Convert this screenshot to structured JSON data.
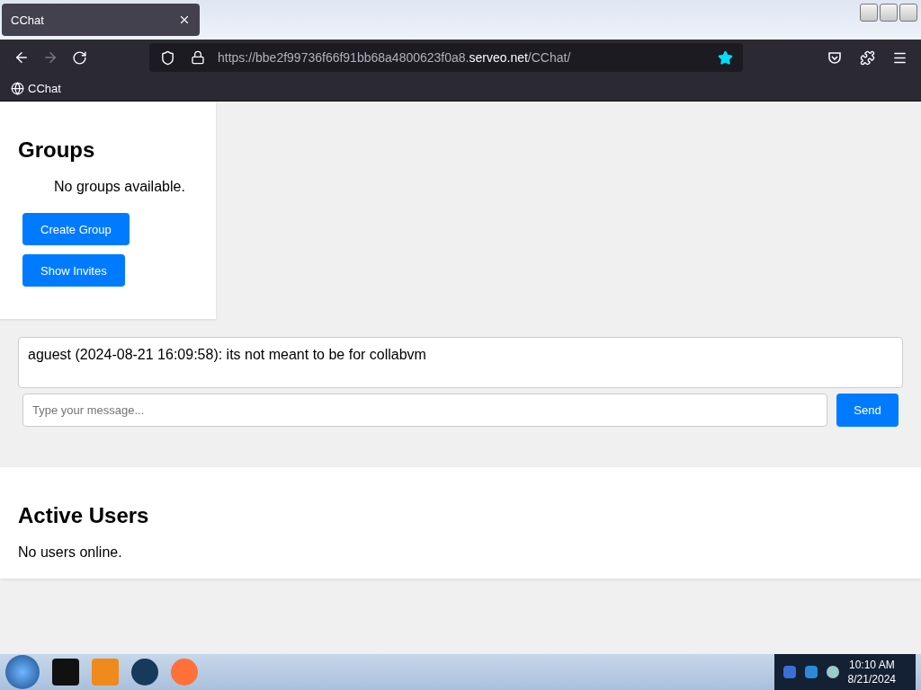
{
  "browser": {
    "tab": {
      "title": "CChat",
      "selected": true
    },
    "url": {
      "prefix": "https://bbe2f99736f66f91bb68a4800623f0a8.",
      "domain": "serveo.net",
      "path": "/CChat/"
    },
    "bookmarks": [
      {
        "label": "CChat"
      }
    ]
  },
  "groups": {
    "title": "Groups",
    "empty": "No groups available.",
    "buttons": [
      "Create Group",
      "Show Invites"
    ]
  },
  "chat": {
    "messages": [
      "aguest (2024-08-21 16:09:58): its not meant to be for collabvm"
    ],
    "input": {
      "placeholder": "Type your message..."
    },
    "send": "Send"
  },
  "users": {
    "title": "Active Users",
    "empty": "No users online."
  },
  "taskbar": {
    "time": "10:10 AM",
    "date": "8/21/2024"
  }
}
